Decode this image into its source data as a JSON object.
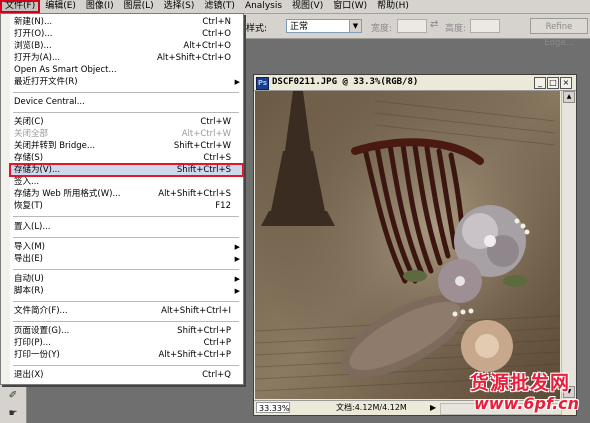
{
  "menubar": {
    "items": [
      "文件(F)",
      "编辑(E)",
      "图像(I)",
      "图层(L)",
      "选择(S)",
      "滤镜(T)",
      "Analysis",
      "视图(V)",
      "窗口(W)",
      "帮助(H)"
    ]
  },
  "options": {
    "style_label": "样式:",
    "style_value": "正常",
    "width_label": "宽度:",
    "height_label": "高度:",
    "swap_icon": "⇄",
    "refine_label": "Refine Edge..."
  },
  "document": {
    "title": "DSCF0211.JPG @ 33.3%(RGB/8)",
    "zoom": "33.33%",
    "doc_size": "文档:4.12M/4.12M",
    "minimize": "_",
    "maximize": "□",
    "close": "×"
  },
  "file_menu": {
    "items": [
      {
        "label": "新建(N)...",
        "shortcut": "Ctrl+N"
      },
      {
        "label": "打开(O)...",
        "shortcut": "Ctrl+O"
      },
      {
        "label": "浏览(B)...",
        "shortcut": "Alt+Ctrl+O"
      },
      {
        "label": "打开为(A)...",
        "shortcut": "Alt+Shift+Ctrl+O"
      },
      {
        "label": "Open As Smart Object...",
        "shortcut": ""
      },
      {
        "label": "最近打开文件(R)",
        "shortcut": "",
        "submenu": true
      },
      {
        "label": "Device Central...",
        "shortcut": ""
      },
      {
        "label": "关闭(C)",
        "shortcut": "Ctrl+W"
      },
      {
        "label": "关闭全部",
        "shortcut": "Alt+Ctrl+W",
        "disabled": true
      },
      {
        "label": "关闭并转到 Bridge...",
        "shortcut": "Shift+Ctrl+W"
      },
      {
        "label": "存储(S)",
        "shortcut": "Ctrl+S"
      },
      {
        "label": "存储为(V)...",
        "shortcut": "Shift+Ctrl+S",
        "highlighted": true
      },
      {
        "label": "签入...",
        "shortcut": ""
      },
      {
        "label": "存储为 Web 所用格式(W)...",
        "shortcut": "Alt+Shift+Ctrl+S"
      },
      {
        "label": "恢复(T)",
        "shortcut": "F12"
      },
      {
        "label": "置入(L)...",
        "shortcut": ""
      },
      {
        "label": "导入(M)",
        "shortcut": "",
        "submenu": true
      },
      {
        "label": "导出(E)",
        "shortcut": "",
        "submenu": true
      },
      {
        "label": "自动(U)",
        "shortcut": "",
        "submenu": true
      },
      {
        "label": "脚本(R)",
        "shortcut": "",
        "submenu": true
      },
      {
        "label": "文件简介(F)...",
        "shortcut": "Alt+Shift+Ctrl+I"
      },
      {
        "label": "页面设置(G)...",
        "shortcut": "Shift+Ctrl+P"
      },
      {
        "label": "打印(P)...",
        "shortcut": "Ctrl+P"
      },
      {
        "label": "打印一份(Y)",
        "shortcut": "Alt+Shift+Ctrl+P"
      },
      {
        "label": "退出(X)",
        "shortcut": "Ctrl+Q"
      }
    ],
    "submenu_arrow": "▶"
  },
  "watermark": {
    "line1": "货源批发网",
    "line2": "www.6pf.cn"
  }
}
